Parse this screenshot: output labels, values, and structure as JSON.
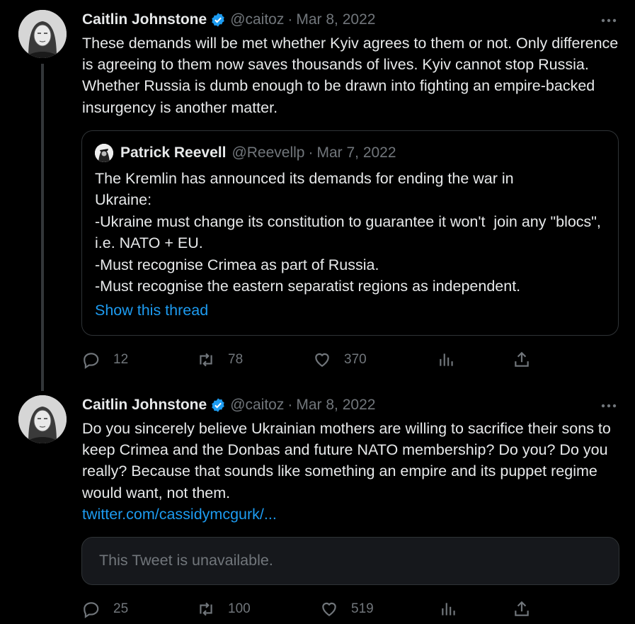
{
  "tweets": [
    {
      "author": {
        "name": "Caitlin Johnstone",
        "handle": "@caitoz",
        "verified": true
      },
      "separator": "·",
      "date": "Mar 8, 2022",
      "text": "These demands will be met whether Kyiv agrees to them or not. Only difference is agreeing to them now saves thousands of lives. Kyiv cannot stop Russia. Whether Russia is dumb enough to be drawn into fighting an empire-backed insurgency is another matter.",
      "quote": {
        "author": {
          "name": "Patrick Reevell",
          "handle": "@Reevellp"
        },
        "separator": "·",
        "date": "Mar 7, 2022",
        "text": "The Kremlin has announced its demands for ending the war in\nUkraine:\n-Ukraine must change its constitution to guarantee it won't  join any \"blocs\", i.e. NATO + EU.\n-Must recognise Crimea as part of Russia.\n-Must recognise the eastern separatist regions as independent.",
        "show_thread": "Show this thread"
      },
      "stats": {
        "replies": "12",
        "retweets": "78",
        "likes": "370"
      }
    },
    {
      "author": {
        "name": "Caitlin Johnstone",
        "handle": "@caitoz",
        "verified": true
      },
      "separator": "·",
      "date": "Mar 8, 2022",
      "text": "Do you sincerely believe Ukrainian mothers are willing to sacrifice their sons to keep Crimea and the Donbas and future NATO membership? Do you? Do you really? Because that sounds like something an empire and its puppet regime would want, not them.",
      "link": "twitter.com/cassidymcgurk/...",
      "unavailable_text": "This Tweet is unavailable.",
      "stats": {
        "replies": "25",
        "retweets": "100",
        "likes": "519"
      }
    }
  ],
  "colors": {
    "background": "#000000",
    "text": "#e7e9ea",
    "muted": "#71767b",
    "accent": "#1d9bf0",
    "border": "#2f3336"
  }
}
